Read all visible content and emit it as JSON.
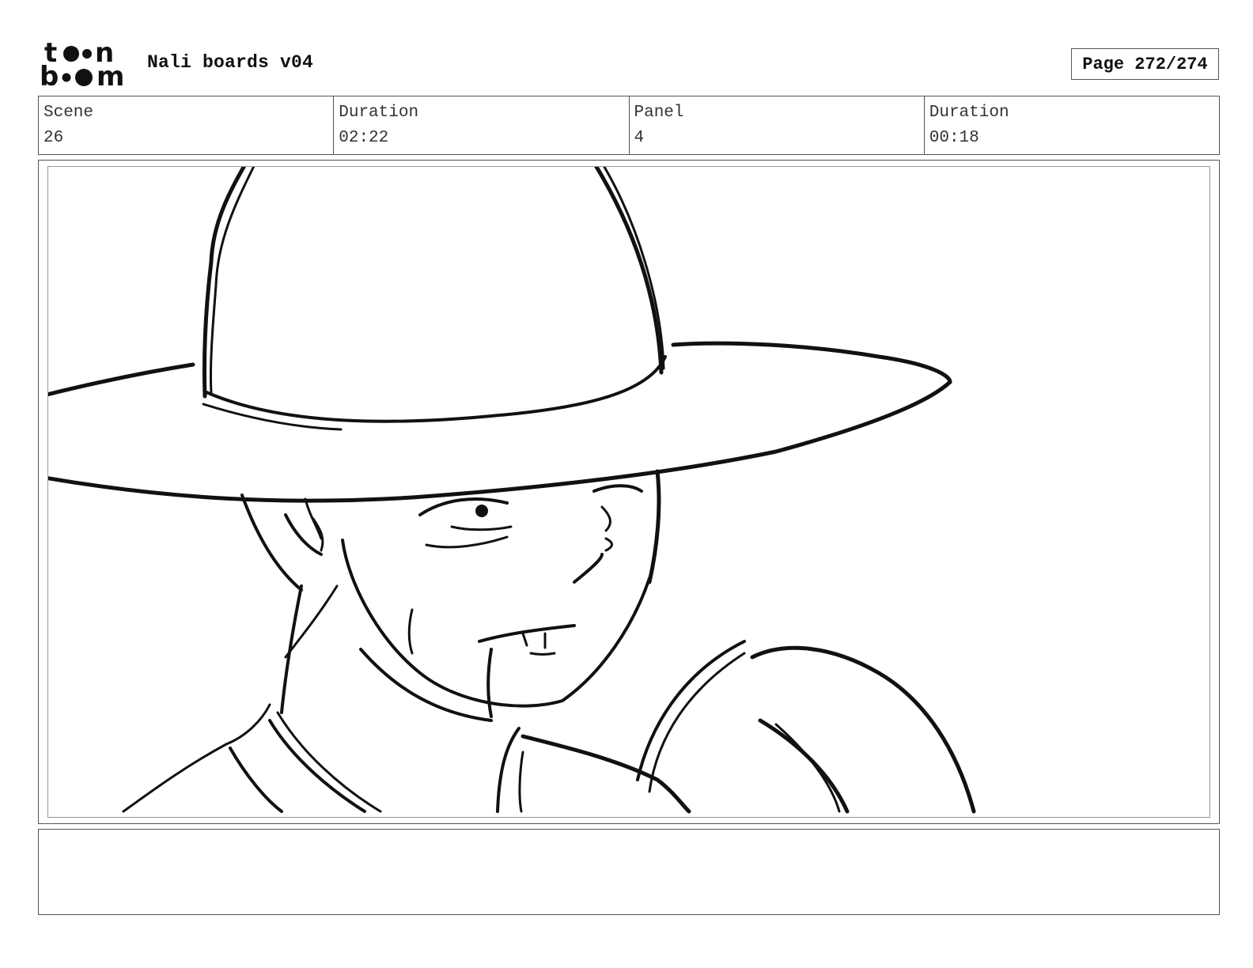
{
  "header": {
    "logo_top": "t  n",
    "logo_bottom": "b  m",
    "title": "Nali boards v04",
    "page": "Page 272/274"
  },
  "info": [
    {
      "label": "Scene",
      "value": "26"
    },
    {
      "label": "Duration",
      "value": "02:22"
    },
    {
      "label": "Panel",
      "value": "4"
    },
    {
      "label": "Duration",
      "value": "00:18"
    }
  ],
  "panel": {
    "sketch": "figure-in-wide-brimmed-hat-sketch"
  },
  "notes": {
    "text": ""
  }
}
